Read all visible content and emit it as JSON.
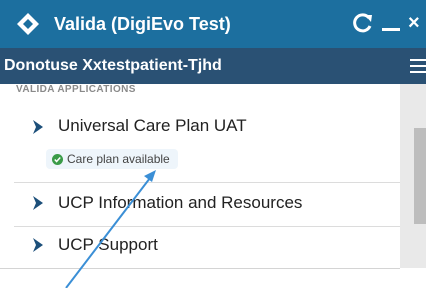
{
  "window": {
    "title": "Valida (DigiEvo Test)",
    "close_glyph": "×",
    "icons": [
      "valida-logo-icon",
      "refresh-icon",
      "minimize-icon",
      "close-icon"
    ]
  },
  "patient": {
    "name": "Donotuse Xxtestpatient-Tjhd",
    "menu_icon": "hamburger-menu-icon"
  },
  "applications": {
    "section_header": "VALIDA APPLICATIONS",
    "items": [
      {
        "label": "Universal Care Plan UAT",
        "status": "Care plan available",
        "status_icon": "check-circle-icon"
      },
      {
        "label": "UCP Information and Resources"
      },
      {
        "label": "UCP Support"
      }
    ]
  },
  "colors": {
    "titlebar": "#1c6f9f",
    "patientbar": "#2a5174",
    "chevron": "#1c4f7a",
    "status_check": "#3a9b48",
    "annotation_arrow": "#3b8fd6"
  }
}
